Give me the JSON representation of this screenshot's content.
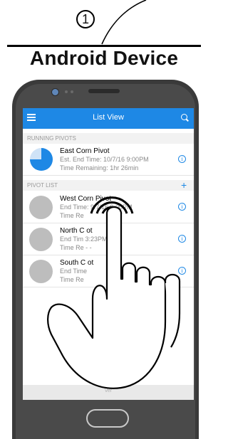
{
  "step_number": "1",
  "device_title": "Android Device",
  "app": {
    "title": "List View",
    "running_header": "RUNNING PIVOTS",
    "running": [
      {
        "name": "East Corn Pivot",
        "line1": "Est. End Time: 10/7/16  9:00PM",
        "line2": "Time Remaining: 1hr 26min",
        "progress": 0.75
      }
    ],
    "list_header": "PIVOT LIST",
    "add_label": "+",
    "info_label": "i",
    "pivots": [
      {
        "name": "West Corn Pivot",
        "line1": "End Time: 9/7/16  9:00PM",
        "line2": "Time Re"
      },
      {
        "name": "North C      ot",
        "line1": "End Tim        3:23PM",
        "line2": "Time Re      - -"
      },
      {
        "name": "South C      ot",
        "line1": "End Time",
        "line2": "Time Re"
      }
    ],
    "footer": "Ver"
  },
  "colors": {
    "accent": "#1e88e5",
    "phone_body": "#3a3a3a",
    "row_circle": "#bdbdbd"
  },
  "icons": {
    "menu": "menu-icon",
    "search": "search-icon",
    "info": "info-icon",
    "hand": "hand-pointer-icon"
  }
}
